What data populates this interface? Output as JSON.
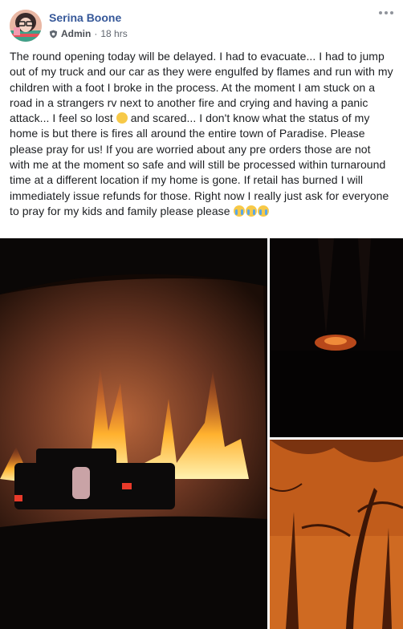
{
  "post": {
    "author_name": "Serina Boone",
    "author_role": "Admin",
    "separator": "·",
    "timestamp": "18 hrs",
    "text_part1": "The round opening today will be delayed. I had to evacuate... I had to jump out of my truck and our car as they were engulfed by flames and run with my children with a foot I broke in the process. At the moment I am stuck on a road in a strangers rv next to another fire and crying and having a panic attack... I feel so lost ",
    "text_part2": " and scared... I don't know what the status of my home is but there is fires all around the entire town of Paradise. Please please pray for us! If you are worried about any pre orders those are not with me at the moment so safe and will still be processed within turnaround time at a different location if my home is gone. If retail has burned I will immediately issue refunds for those. Right now I really just ask for everyone to pray for my kids and family please please ",
    "more_icon": "more-options-icon",
    "emoji_icons": [
      "disappointed-face-icon",
      "loudly-crying-face-icon"
    ]
  },
  "photos": [
    {
      "name": "photo-fire-through-windshield"
    },
    {
      "name": "photo-fire-at-night"
    },
    {
      "name": "photo-orange-smoke-trees"
    }
  ]
}
